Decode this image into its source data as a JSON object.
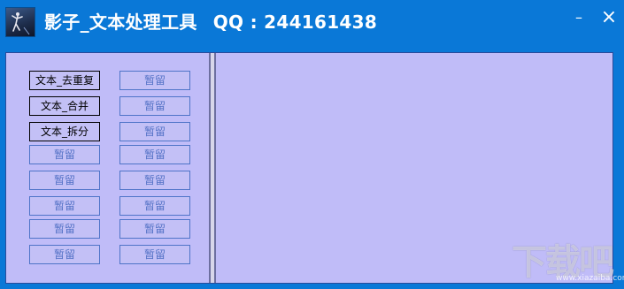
{
  "titlebar": {
    "title": "影子_文本处理工具",
    "qq": "QQ : 244161438",
    "minimize_glyph": "–",
    "close_glyph": "×",
    "app_icon": "shadow-figure-icon"
  },
  "buttons": {
    "col1": [
      "文本_去重复",
      "文本_合并",
      "文本_拆分",
      "暂留",
      "暂留",
      "暂留",
      "暂留",
      "暂留"
    ],
    "col2": [
      "暂留",
      "暂留",
      "暂留",
      "暂留",
      "暂留",
      "暂留",
      "暂留",
      "暂留"
    ],
    "active_count_col1": 3
  },
  "watermark": {
    "text": "下载吧",
    "sub": "www.xiazaiba.com"
  },
  "colors": {
    "titlebar_bg": "#0a78d7",
    "panel_bg": "#c0bcf8",
    "disabled_text": "#5472c6",
    "active_text": "#000000"
  }
}
